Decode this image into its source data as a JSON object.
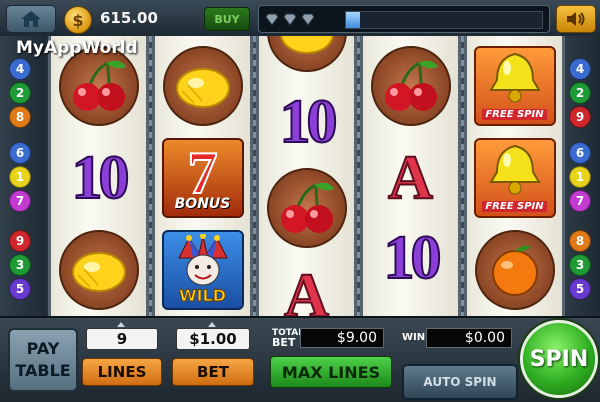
{
  "topbar": {
    "balance": "615.00",
    "buy_label": "BUY",
    "xp_gems": 3,
    "xp_progress": 0.07,
    "icons": {
      "home": "home-icon",
      "coin": "coin-icon",
      "sound": "speaker-icon",
      "gem": "diamond-gem-icon"
    }
  },
  "watermark": "MyAppWorld",
  "paylines": {
    "left": [
      "4",
      "2",
      "8",
      "6",
      "1",
      "7",
      "9",
      "3",
      "5"
    ],
    "right": [
      "4",
      "2",
      "9",
      "6",
      "1",
      "7",
      "8",
      "3",
      "5"
    ]
  },
  "reels": [
    [
      "cherry",
      "ten",
      "lemon"
    ],
    [
      "lemon",
      "seven-bonus",
      "joker-wild"
    ],
    [
      "lemon",
      "ten",
      "cherry",
      "ace"
    ],
    [
      "cherry",
      "ace",
      "ten"
    ],
    [
      "bell-free-spin",
      "bell-free-spin",
      "orange"
    ]
  ],
  "symbol_text": {
    "ten": "10",
    "ace": "A",
    "seven": "7",
    "bonus": "BONUS",
    "wild": "WILD",
    "free_spin": "FREE SPIN"
  },
  "controls": {
    "pay_table_line1": "PAY",
    "pay_table_line2": "TABLE",
    "lines_value": "9",
    "lines_label": "LINES",
    "bet_value": "$1.00",
    "bet_label": "BET",
    "total_bet_label_1": "TOTAL",
    "total_bet_label_2": "BET",
    "total_bet_value": "$9.00",
    "win_label": "WIN",
    "win_value": "$0.00",
    "max_lines_label": "MAX LINES",
    "auto_spin_label": "AUTO SPIN",
    "spin_label": "SPIN"
  },
  "colors": {
    "line_badges": {
      "1": "#e8d21c",
      "2": "#1f9a36",
      "3": "#1f9a36",
      "4": "#3a6bd0",
      "5": "#6a3ad0",
      "6": "#3a6bd0",
      "7": "#c23ad0",
      "8": "#e07a18",
      "9": "#d0262e"
    }
  }
}
